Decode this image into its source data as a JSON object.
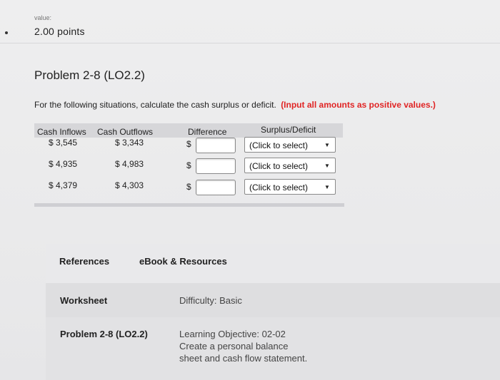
{
  "header": {
    "value_label": "value:",
    "points": "2.00 points"
  },
  "problem": {
    "title": "Problem 2-8 (LO2.2)",
    "instructions": "For the following situations, calculate the cash surplus or deficit.",
    "instructions_highlight": "(Input all amounts as positive values.)"
  },
  "table": {
    "headers": {
      "cash_inflows": "Cash Inflows",
      "cash_outflows": "Cash Outflows",
      "difference": "Difference",
      "surplus_deficit": "Surplus/Deficit"
    },
    "rows": [
      {
        "inflow": "$ 3,545",
        "outflow": "$ 3,343",
        "currency": "$",
        "difference_value": "",
        "select": "(Click to select)"
      },
      {
        "inflow": "$ 4,935",
        "outflow": "$ 4,983",
        "currency": "$",
        "difference_value": "",
        "select": "(Click to select)"
      },
      {
        "inflow": "$ 4,379",
        "outflow": "$ 4,303",
        "currency": "$",
        "difference_value": "",
        "select": "(Click to select)"
      }
    ]
  },
  "references": {
    "tab_references": "References",
    "tab_ebook": "eBook & Resources",
    "worksheet_label": "Worksheet",
    "difficulty": "Difficulty: Basic",
    "problem_label": "Problem 2-8 (LO2.2)",
    "learning_objective": "Learning Objective: 02-02 Create a personal balance sheet and cash flow statement."
  },
  "colors": {
    "highlight_red": "#e02424",
    "background": "#ececed"
  }
}
